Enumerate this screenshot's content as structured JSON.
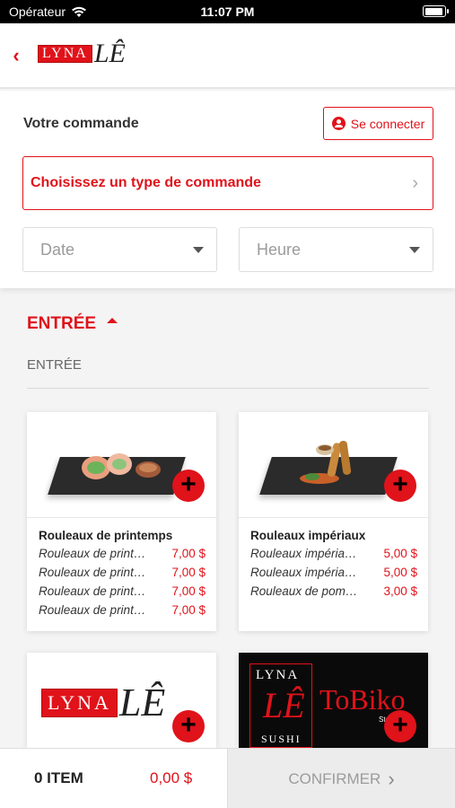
{
  "status_bar": {
    "carrier": "Opérateur",
    "time": "11:07 PM"
  },
  "header": {
    "logo_text_box": "LYNA",
    "logo_text_le": "LÊ"
  },
  "order": {
    "title": "Votre commande",
    "connect_label": "Se connecter",
    "type_label": "Choisissez un type de commande",
    "date_placeholder": "Date",
    "hour_placeholder": "Heure"
  },
  "section": {
    "title": "ENTRÉE",
    "subtitle": "ENTRÉE"
  },
  "cards": [
    {
      "name": "Rouleaux de printemps",
      "rows": [
        {
          "name": "Rouleaux de print…",
          "price": "7,00 $"
        },
        {
          "name": "Rouleaux de print…",
          "price": "7,00 $"
        },
        {
          "name": "Rouleaux de print…",
          "price": "7,00 $"
        },
        {
          "name": "Rouleaux de print…",
          "price": "7,00 $"
        }
      ]
    },
    {
      "name": "Rouleaux impériaux",
      "rows": [
        {
          "name": "Rouleaux impéria…",
          "price": "5,00 $"
        },
        {
          "name": "Rouleaux impéria…",
          "price": "5,00 $"
        },
        {
          "name": "Rouleaux de pom…",
          "price": "3,00 $"
        }
      ]
    }
  ],
  "card3_logo": {
    "box": "LYNA",
    "le": "LÊ"
  },
  "card4_logo": {
    "top": "LYNA",
    "le": "LÊ",
    "bottom": "SUSHI",
    "brand": "ToBiko",
    "tag": "Steak & S"
  },
  "bottom_bar": {
    "count": "0 ITEM",
    "total": "0,00 $",
    "confirm_label": "CONFIRMER"
  },
  "colors": {
    "accent": "#e0121a"
  }
}
